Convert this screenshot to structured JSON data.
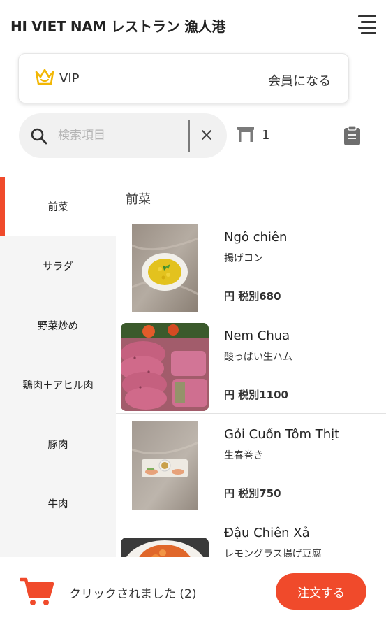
{
  "header": {
    "title": "HI VIET NAM レストラン 漁人港",
    "menu_icon": "hamburger-menu-icon"
  },
  "vip": {
    "label": "VIP",
    "action": "会員になる",
    "icon": "crown-icon",
    "icon_color": "#f2b705"
  },
  "search": {
    "placeholder": "検索項目",
    "value": "",
    "icon": "search-icon",
    "clear_icon": "close-icon"
  },
  "table": {
    "icon": "table-icon",
    "number": "1"
  },
  "clipboard_icon": "clipboard-icon",
  "categories": [
    {
      "label": "前菜",
      "active": true
    },
    {
      "label": "サラダ",
      "active": false
    },
    {
      "label": "野菜炒め",
      "active": false
    },
    {
      "label": "鶏肉＋アヒル肉",
      "active": false
    },
    {
      "label": "豚肉",
      "active": false
    },
    {
      "label": "牛肉",
      "active": false
    }
  ],
  "section": {
    "title": "前菜"
  },
  "items": [
    {
      "name": "Ngô chiên",
      "subtitle": "揚げコン",
      "price": "円 税別680"
    },
    {
      "name": "Nem Chua",
      "subtitle": "酸っぱい生ハム",
      "price": "円 税別1100"
    },
    {
      "name": "Gỏi Cuốn Tôm Thịt",
      "subtitle": "生春巻き",
      "price": "円 税別750"
    },
    {
      "name": "Đậu Chiên Xả",
      "subtitle": "レモングラス揚げ豆腐",
      "price": ""
    }
  ],
  "cart": {
    "icon": "shopping-cart-icon",
    "text": "クリックされました (2)"
  },
  "order_button": {
    "label": "注文する"
  },
  "colors": {
    "accent": "#f04a2b",
    "sidebar_bg": "#f5f5f5",
    "search_bg": "#f1f1f1"
  }
}
